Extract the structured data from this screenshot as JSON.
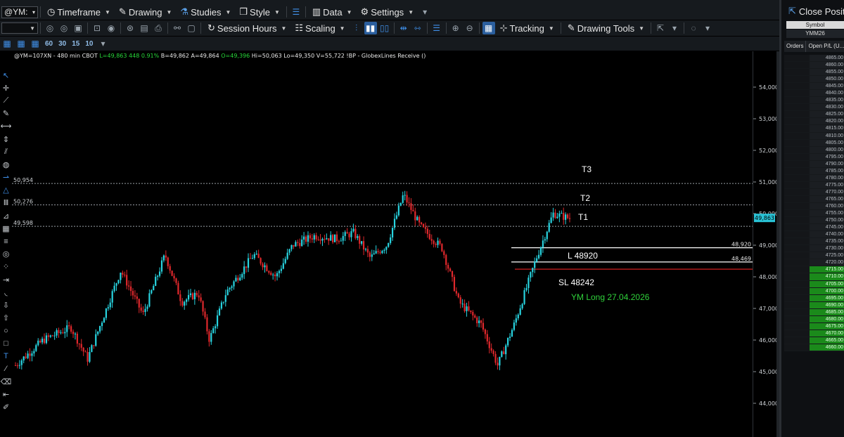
{
  "toolbar1": {
    "symbol": "@YM:",
    "timeframe": "Timeframe",
    "drawing": "Drawing",
    "studies": "Studies",
    "style": "Style",
    "data": "Data",
    "settings": "Settings"
  },
  "toolbar2": {
    "session_hours": "Session Hours",
    "scaling": "Scaling",
    "tracking": "Tracking",
    "drawing_tools": "Drawing Tools"
  },
  "toolbar3": {
    "timeframes": [
      "60",
      "30",
      "15",
      "10"
    ]
  },
  "info": {
    "prefix": "@YM=107XN - 480 min  CBOT",
    "last": "L=49,863  448  0.91%",
    "bid_ask": "B=49,862  A=49,864",
    "open": "O=49,396",
    "rest": "Hi=50,063  Lo=49,350  V=55,722  !BP - GlobexLines Receive ()"
  },
  "chart_data": {
    "type": "candlestick",
    "price_axis": {
      "ticks": [
        "54,000",
        "53,000",
        "52,000",
        "51,000",
        "50,000",
        "49,000",
        "48,000",
        "47,000",
        "46,000",
        "45,000",
        "44,000"
      ],
      "ylim": [
        43500,
        55000
      ]
    },
    "current_price": "49,863",
    "colors": {
      "up": "#28d4e0",
      "down": "#e0282c",
      "entry": "#ffffff",
      "stop": "#d01f1f",
      "dotted": "#9aa0a6",
      "label_green": "#2fd13a"
    },
    "horizontal_levels": [
      {
        "price": 50954,
        "label": "50,954",
        "style": "dotted"
      },
      {
        "price": 50276,
        "label": "50,276",
        "style": "dotted"
      },
      {
        "price": 49598,
        "label": "49,598",
        "style": "dotted"
      },
      {
        "price": 48920,
        "label": "48,920",
        "style": "solid",
        "color": "entry"
      },
      {
        "price": 48469,
        "label": "48,469",
        "style": "solid",
        "color": "entry"
      },
      {
        "price": 48242,
        "label": "",
        "style": "solid",
        "color": "stop"
      }
    ],
    "annotations": [
      {
        "text": "T3"
      },
      {
        "text": "T2"
      },
      {
        "text": "T1"
      },
      {
        "text": "L 48920"
      },
      {
        "text": "SL  48242"
      },
      {
        "text": "YM Long 27.04.2026"
      }
    ],
    "swing_path": [
      {
        "x": 0,
        "price": 45200
      },
      {
        "x": 0.05,
        "price": 46000
      },
      {
        "x": 0.1,
        "price": 46400
      },
      {
        "x": 0.13,
        "price": 45400
      },
      {
        "x": 0.19,
        "price": 48200
      },
      {
        "x": 0.23,
        "price": 46800
      },
      {
        "x": 0.27,
        "price": 48700
      },
      {
        "x": 0.3,
        "price": 47200
      },
      {
        "x": 0.33,
        "price": 47500
      },
      {
        "x": 0.35,
        "price": 46000
      },
      {
        "x": 0.38,
        "price": 47500
      },
      {
        "x": 0.43,
        "price": 48700
      },
      {
        "x": 0.47,
        "price": 48000
      },
      {
        "x": 0.5,
        "price": 49000
      },
      {
        "x": 0.54,
        "price": 49300
      },
      {
        "x": 0.58,
        "price": 49200
      },
      {
        "x": 0.61,
        "price": 49400
      },
      {
        "x": 0.64,
        "price": 48600
      },
      {
        "x": 0.67,
        "price": 49000
      },
      {
        "x": 0.7,
        "price": 50600
      },
      {
        "x": 0.73,
        "price": 49600
      },
      {
        "x": 0.77,
        "price": 48900
      },
      {
        "x": 0.8,
        "price": 47200
      },
      {
        "x": 0.84,
        "price": 46500
      },
      {
        "x": 0.87,
        "price": 45200
      },
      {
        "x": 0.9,
        "price": 46500
      },
      {
        "x": 0.94,
        "price": 48600
      },
      {
        "x": 0.97,
        "price": 50000
      },
      {
        "x": 1,
        "price": 49850
      }
    ]
  },
  "right_panel": {
    "close_position": "Close Positio",
    "symbol_header": "Symbol",
    "symbol_value": "YMM26",
    "tabs": [
      "Orders",
      "Open P/L (U..."
    ],
    "ladder_prices": [
      "4865.00",
      "4860.00",
      "4855.00",
      "4850.00",
      "4845.00",
      "4840.00",
      "4835.00",
      "4830.00",
      "4825.00",
      "4820.00",
      "4815.00",
      "4810.00",
      "4805.00",
      "4800.00",
      "4795.00",
      "4790.00",
      "4785.00",
      "4780.00",
      "4775.00",
      "4770.00",
      "4765.00",
      "4760.00",
      "4755.00",
      "4750.00",
      "4745.00",
      "4740.00",
      "4735.00",
      "4730.00",
      "4725.00",
      "4720.00",
      "4715.00",
      "4710.00",
      "4705.00",
      "4700.00",
      "4695.00",
      "4690.00",
      "4685.00",
      "4680.00",
      "4675.00",
      "4670.00",
      "4665.00",
      "4660.00"
    ],
    "ladder_green_from": 30
  }
}
